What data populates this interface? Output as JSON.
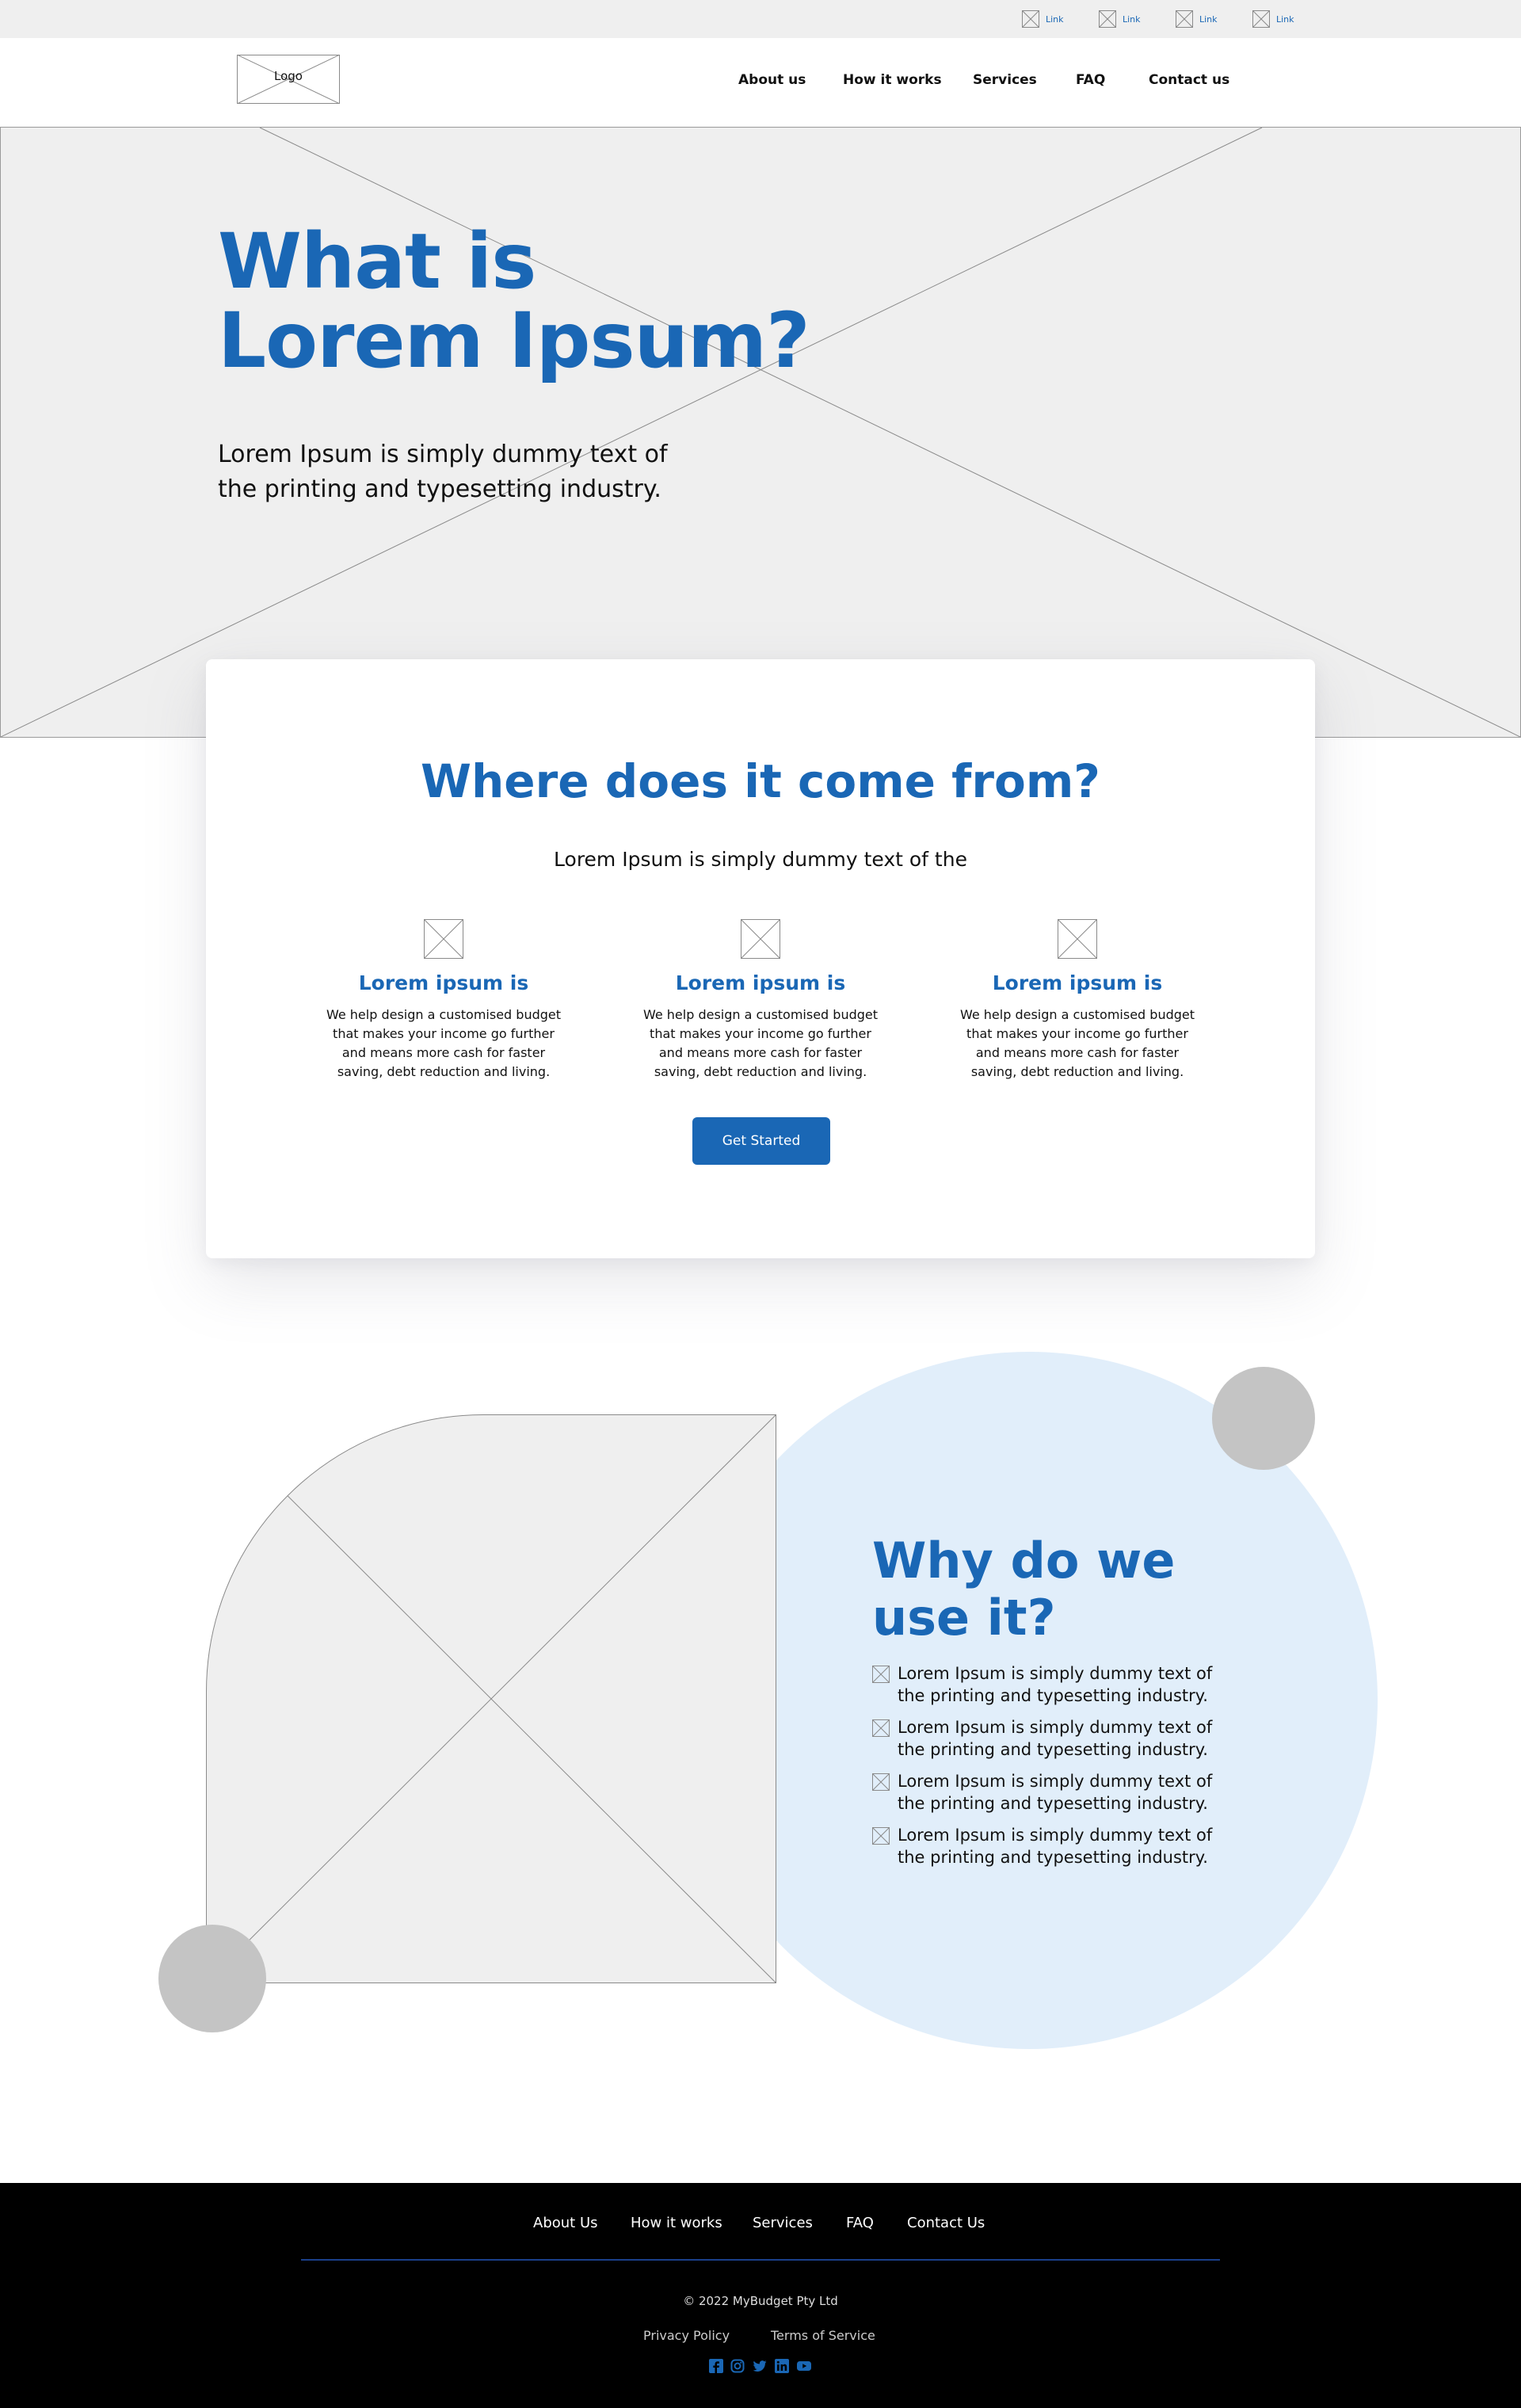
{
  "utility_bar": {
    "links": [
      "Link",
      "Link",
      "Link",
      "Link"
    ]
  },
  "header": {
    "logo_label": "Logo",
    "nav": [
      "About us",
      "How it works",
      "Services",
      "FAQ",
      "Contact us"
    ]
  },
  "hero": {
    "title_line1": "What is",
    "title_line2": "Lorem Ipsum?",
    "subtitle_line1": "Lorem Ipsum is simply dummy text of",
    "subtitle_line2": "the printing and typesetting industry."
  },
  "origin": {
    "title": "Where does it come from?",
    "subtitle": "Lorem Ipsum is simply dummy text of the",
    "features": [
      {
        "title": "Lorem ipsum is",
        "desc_lines": [
          "We help design a customised budget",
          "that makes your income go further",
          "and means more cash for faster",
          "saving, debt reduction and living."
        ]
      },
      {
        "title": "Lorem ipsum is",
        "desc_lines": [
          "We help design a customised budget",
          "that makes your income go further",
          "and means more cash for faster",
          "saving, debt reduction and living."
        ]
      },
      {
        "title": "Lorem ipsum is",
        "desc_lines": [
          "We help design a customised budget",
          "that makes your income go further",
          "and means more cash for faster",
          "saving, debt reduction and living."
        ]
      }
    ],
    "cta_label": "Get Started"
  },
  "why": {
    "title_line1": "Why do we",
    "title_line2": "use it?",
    "items": [
      {
        "line1": "Lorem Ipsum is simply dummy text of",
        "line2": "the printing and typesetting industry."
      },
      {
        "line1": "Lorem Ipsum is simply dummy text of",
        "line2": "the printing and typesetting industry."
      },
      {
        "line1": "Lorem Ipsum is simply dummy text of",
        "line2": "the printing and typesetting industry."
      },
      {
        "line1": "Lorem Ipsum is simply dummy text of",
        "line2": "the printing and typesetting industry."
      }
    ]
  },
  "footer": {
    "nav": [
      "About Us",
      "How it works",
      "Services",
      "FAQ",
      "Contact Us"
    ],
    "copyright": "© 2022 MyBudget Pty Ltd",
    "privacy_label": "Privacy Policy",
    "terms_label": "Terms of Service",
    "social_icons": [
      "facebook-icon",
      "instagram-icon",
      "twitter-icon",
      "linkedin-icon",
      "youtube-icon"
    ]
  },
  "colors": {
    "brand_blue": "#1a67b5",
    "light_blue": "#e1eefa",
    "placeholder_gray": "#efefef",
    "accent_circle_gray": "#c4c4c4",
    "footer_bg": "#000000"
  }
}
